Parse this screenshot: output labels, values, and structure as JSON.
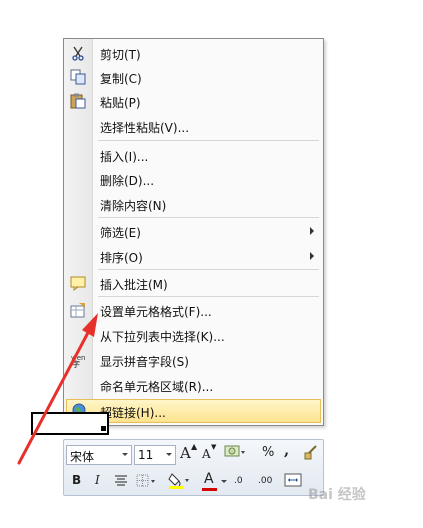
{
  "menu": {
    "items": [
      {
        "label": "剪切(T)",
        "icon": "scissors-icon"
      },
      {
        "label": "复制(C)",
        "icon": "copy-icon"
      },
      {
        "label": "粘贴(P)",
        "icon": "paste-icon"
      },
      {
        "label": "选择性粘贴(V)...",
        "icon": ""
      },
      {
        "label": "插入(I)...",
        "icon": ""
      },
      {
        "label": "删除(D)...",
        "icon": ""
      },
      {
        "label": "清除内容(N)",
        "icon": ""
      },
      {
        "label": "筛选(E)",
        "icon": "",
        "submenu": true
      },
      {
        "label": "排序(O)",
        "icon": "",
        "submenu": true
      },
      {
        "label": "插入批注(M)",
        "icon": "comment-icon"
      },
      {
        "label": "设置单元格格式(F)...",
        "icon": "format-cells-icon"
      },
      {
        "label": "从下拉列表中选择(K)...",
        "icon": ""
      },
      {
        "label": "显示拼音字段(S)",
        "icon": "phonetic-icon"
      },
      {
        "label": "命名单元格区域(R)...",
        "icon": ""
      },
      {
        "label": "超链接(H)...",
        "icon": "hyperlink-globe-icon",
        "highlighted": true
      }
    ]
  },
  "mini_toolbar": {
    "font_name": "宋体",
    "font_size": "11",
    "grow_label": "A",
    "shrink_label": "A",
    "percent": "%",
    "comma": ",",
    "bold": "B",
    "italic": "I",
    "font_color_label": "A",
    "increase_decimal": ".0",
    "decrease_decimal": ".00"
  },
  "watermark": "Bai 经验",
  "colors": {
    "highlight_top": "#fff6c8",
    "highlight_bottom": "#fde38f",
    "annotation_arrow": "#e8302a",
    "font_color_bar": "#d40000",
    "fill_color_bar": "#ffff00"
  }
}
